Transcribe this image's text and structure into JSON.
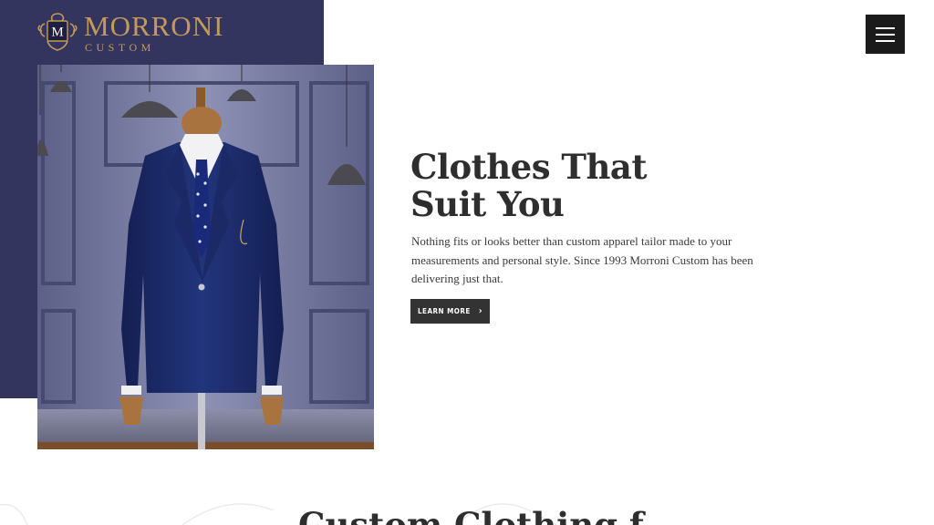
{
  "brand": {
    "name": "MORRONI",
    "subtitle": "CUSTOM",
    "monogram": "M",
    "gold": "#c39a5a",
    "navy": "#34355f"
  },
  "nav": {
    "menu_icon": "hamburger-menu-icon"
  },
  "hero": {
    "title_line1": "Clothes That",
    "title_line2": "Suit You",
    "body": "Nothing fits or looks better than custom apparel tailor made to your measurements and personal style. Since 1993 Morroni Custom has been delivering just that.",
    "cta_label": "LEARN MORE",
    "cta_icon": "chevron-right-icon"
  },
  "section": {
    "title": "Custom Clothing f"
  }
}
